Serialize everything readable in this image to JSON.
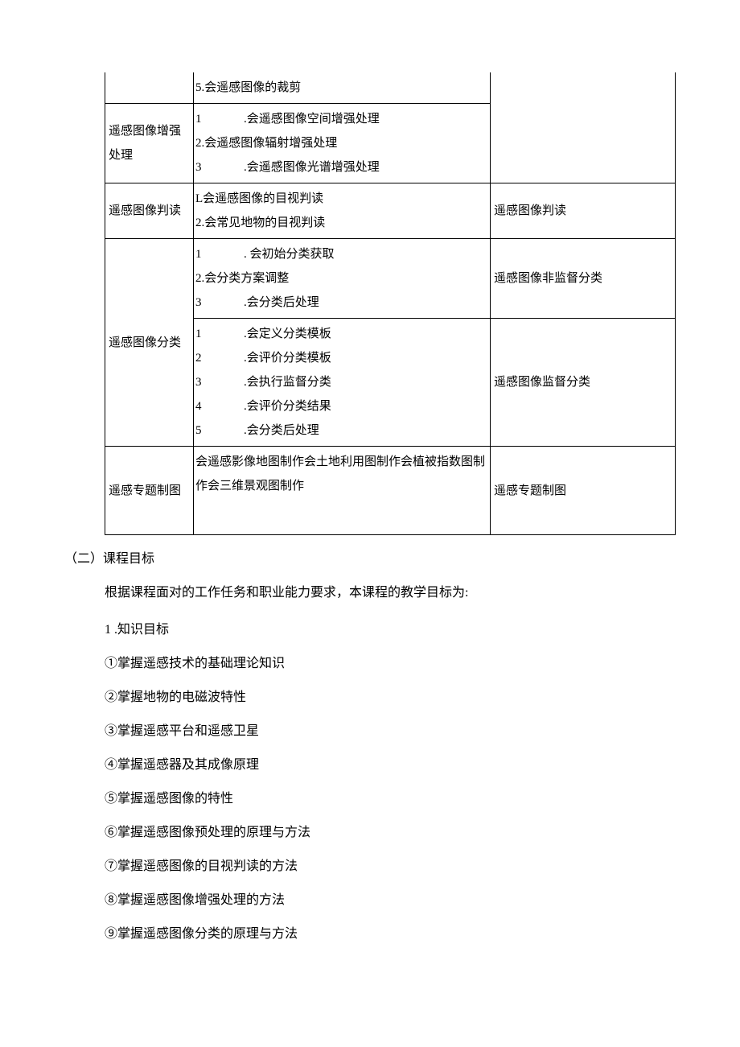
{
  "table": {
    "r0": {
      "skill": "5.会遥感图像的裁剪"
    },
    "r1": {
      "topic": "遥感图像增强处理",
      "sk1_num": "1",
      "sk1_txt": ".会遥感图像空间增强处理",
      "sk2": "2.会遥感图像辐射增强处理",
      "sk3_num": "3",
      "sk3_txt": ".会遥感图像光谱增强处理"
    },
    "r2": {
      "topic": "遥感图像判读",
      "sk1": "L会遥感图像的目视判读",
      "sk2": "2.会常见地物的目视判读",
      "work": "遥感图像判读"
    },
    "r3": {
      "topic": "遥感图像分类",
      "a1_num": "1",
      "a1_txt": ". 会初始分类获取",
      "a2": "2.会分类方案调整",
      "a3_num": "3",
      "a3_txt": ".会分类后处理",
      "workA": "遥感图像非监督分类",
      "b1_num": "1",
      "b1_txt": ".会定义分类模板",
      "b2_num": "2",
      "b2_txt": ".会评价分类模板",
      "b3_num": "3",
      "b3_txt": ".会执行监督分类",
      "b4_num": "4",
      "b4_txt": ".会评价分类结果",
      "b5_num": "5",
      "b5_txt": ".会分类后处理",
      "workB": "遥感图像监督分类"
    },
    "r4": {
      "topic": "遥感专题制图",
      "skill": "会遥感影像地图制作会土地利用图制作会植被指数图制作会三维景观图制作",
      "work": "遥感专题制图"
    }
  },
  "heading": "（二）课程目标",
  "intro": "根据课程面对的工作任务和职业能力要求，本课程的教学目标为:",
  "knowHead": "1 .知识目标",
  "goals": {
    "g1": "①掌握遥感技术的基础理论知识",
    "g2": "②掌握地物的电磁波特性",
    "g3": "③掌握遥感平台和遥感卫星",
    "g4": "④掌握遥感器及其成像原理",
    "g5": "⑤掌握遥感图像的特性",
    "g6": "⑥掌握遥感图像预处理的原理与方法",
    "g7": "⑦掌握遥感图像的目视判读的方法",
    "g8": "⑧掌握遥感图像增强处理的方法",
    "g9": "⑨掌握遥感图像分类的原理与方法"
  }
}
